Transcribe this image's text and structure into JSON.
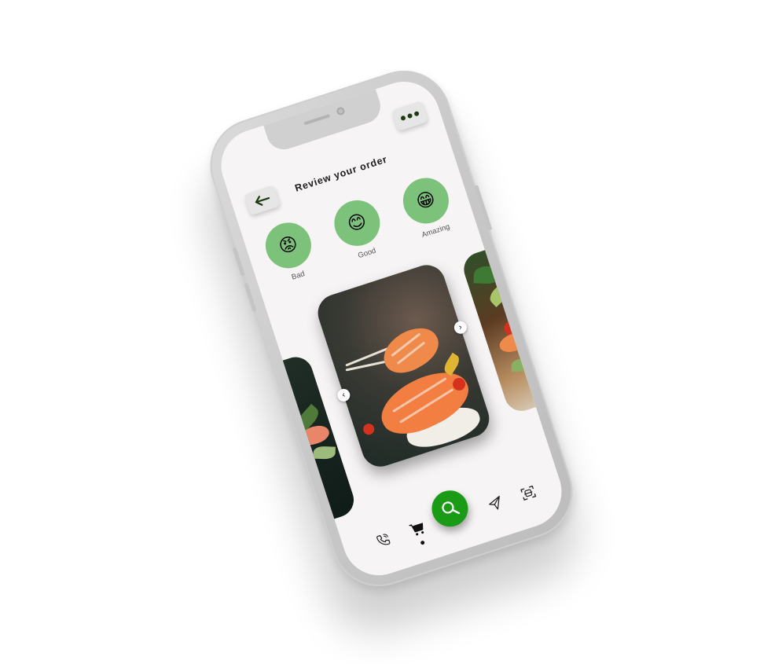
{
  "header": {
    "title": "Review your order",
    "back_icon": "arrow-left-icon",
    "more_icon": "more-dots-icon"
  },
  "ratings": [
    {
      "label": "Bad",
      "emoji": "😡"
    },
    {
      "label": "Good",
      "emoji": "😊"
    },
    {
      "label": "Amazing",
      "emoji": "😁"
    }
  ],
  "carousel": {
    "prev_glyph": "‹",
    "next_glyph": "›"
  },
  "bottom_nav": {
    "items": [
      "phone-icon",
      "cart-icon",
      "search-icon",
      "send-icon",
      "scan-icon"
    ],
    "active": "cart-icon"
  },
  "colors": {
    "accent": "#1a9b16",
    "rating_bg": "#7dc27a",
    "screen_bg": "#f6f4f4",
    "frame": "#c9c9c9"
  }
}
